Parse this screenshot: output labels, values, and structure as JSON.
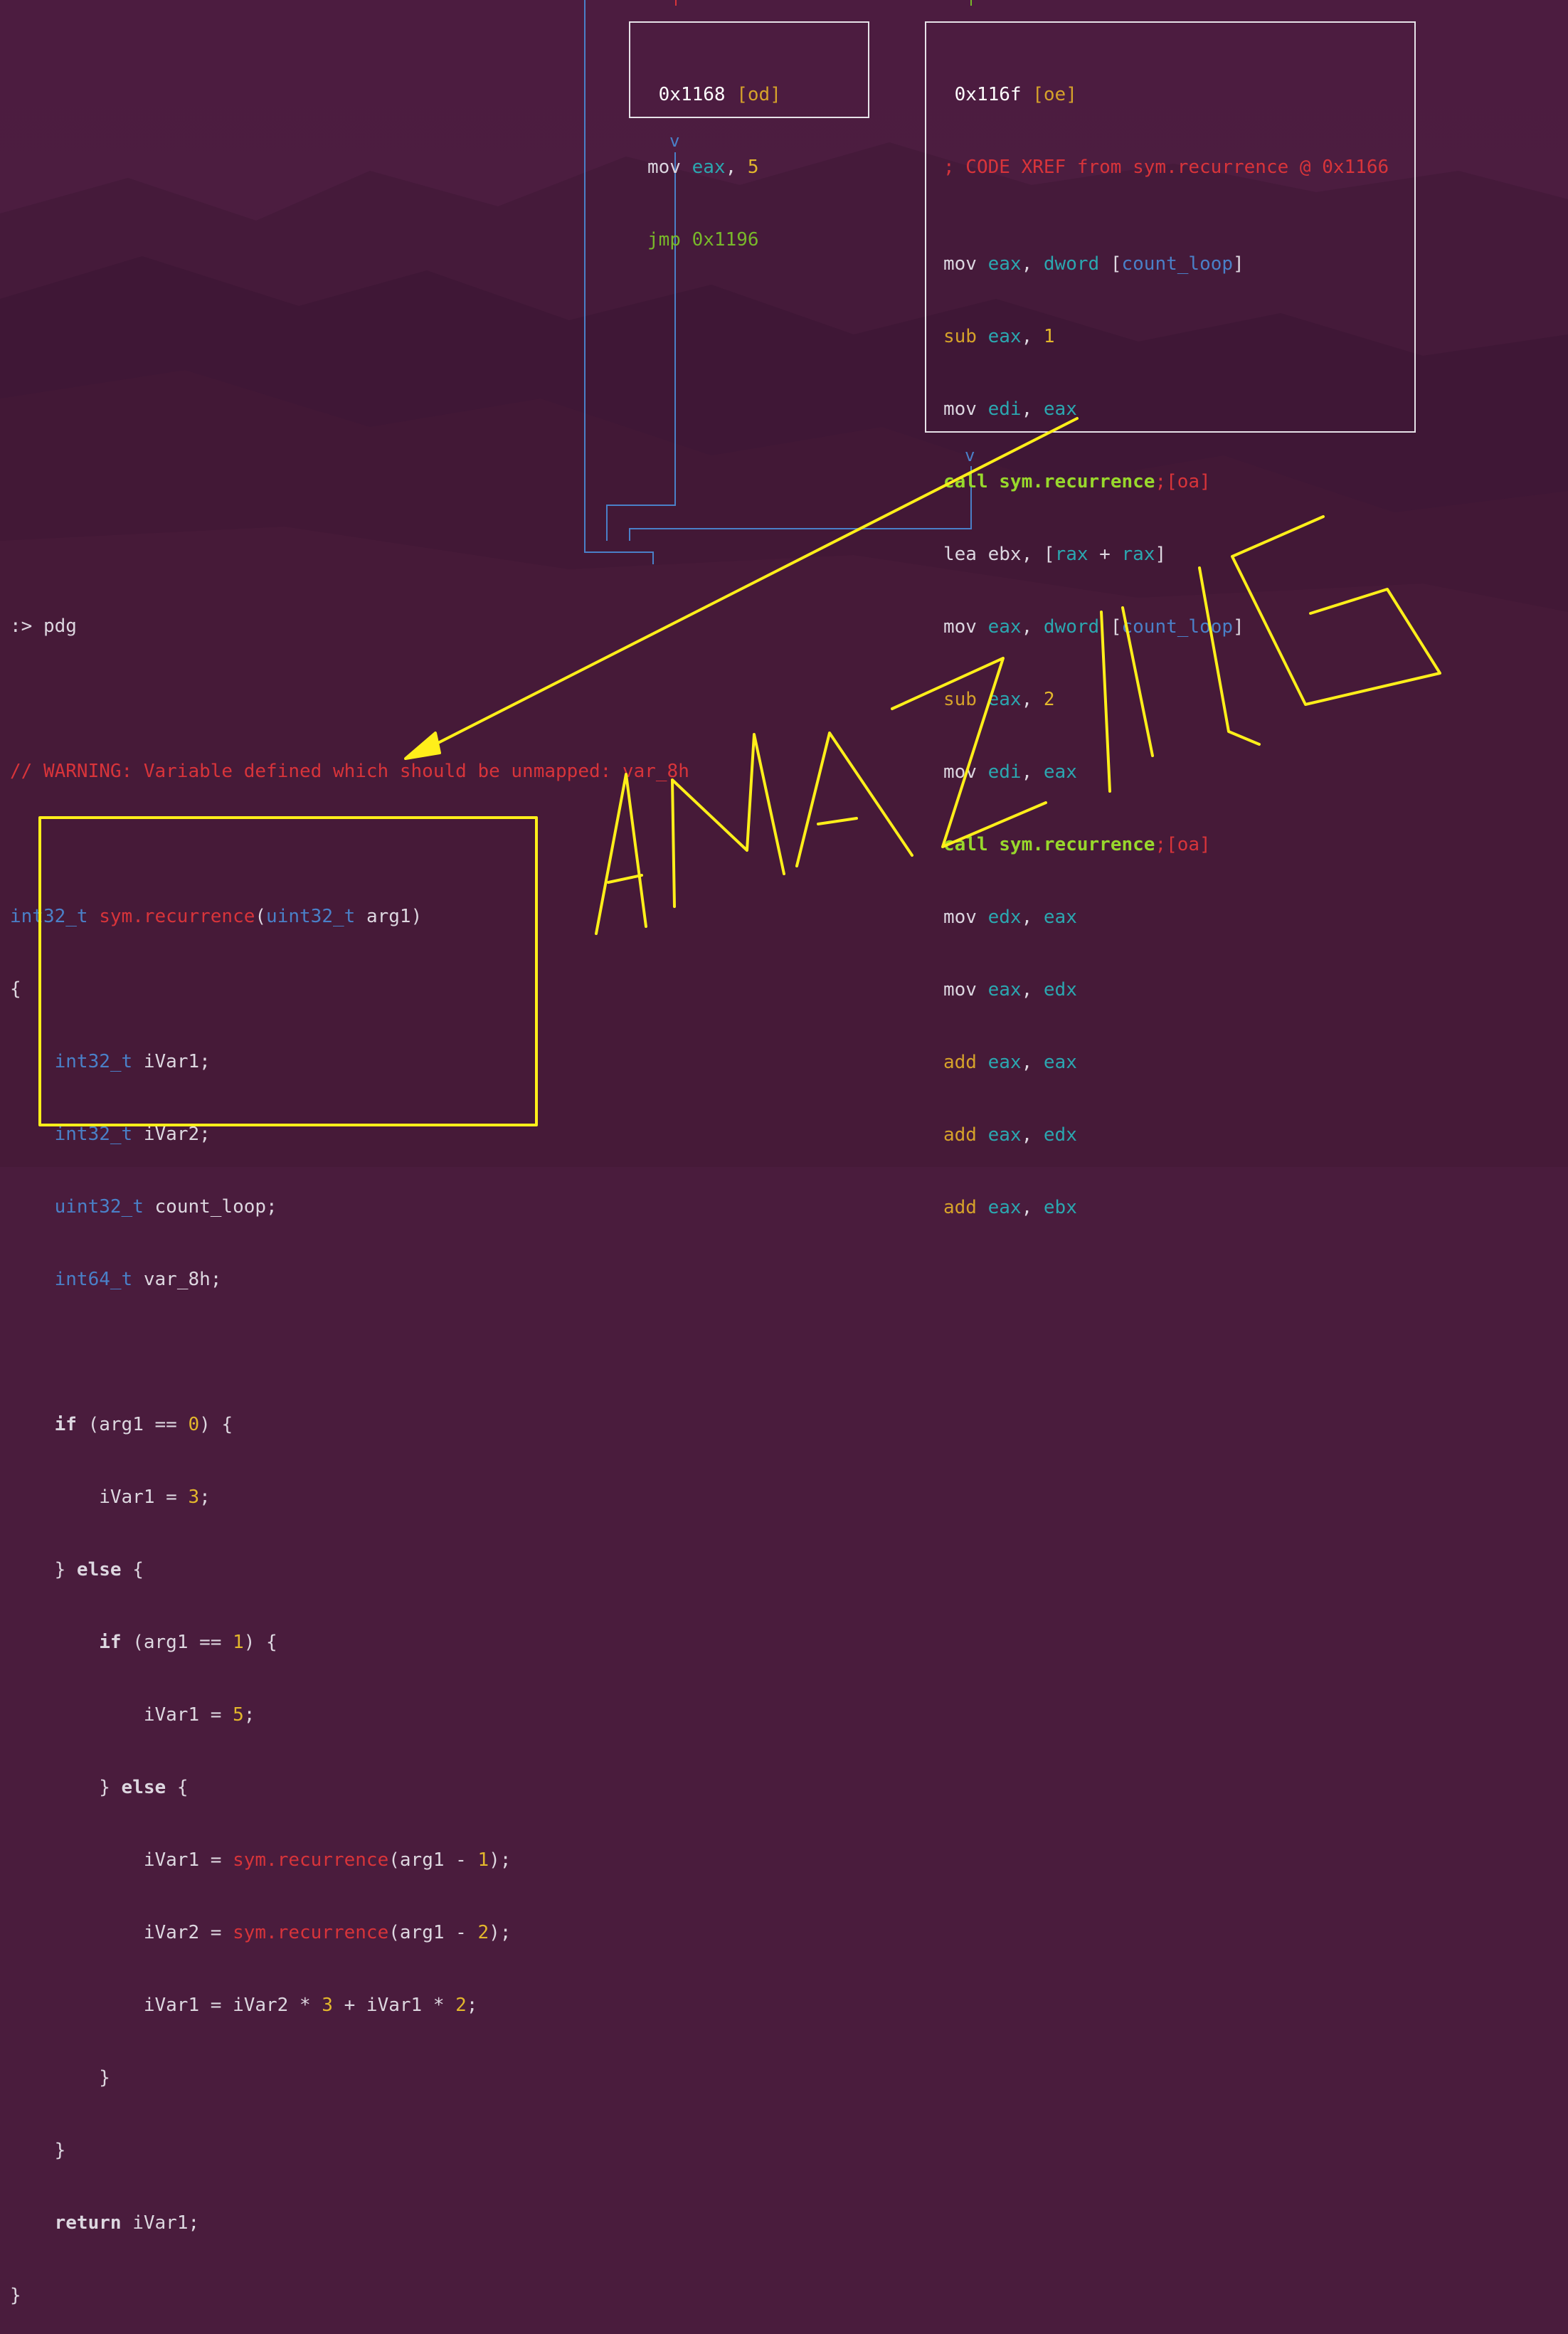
{
  "graph": {
    "block_od": {
      "header_addr": "0x1168",
      "header_tag": "[od]",
      "lines": [
        {
          "op": "mov",
          "a": "eax",
          "sep": ", ",
          "b": "5"
        },
        {
          "op": "jmp",
          "a": "0x1196"
        }
      ]
    },
    "block_oe": {
      "header_addr": "0x116f",
      "header_tag": "[oe]",
      "xref": "; CODE XREF from sym.recurrence @ 0x1166",
      "lines": [
        {
          "op": "mov",
          "a": "eax",
          "sep": ", ",
          "b": "dword",
          "mem": "count_loop"
        },
        {
          "op": "sub",
          "a": "eax",
          "sep": ", ",
          "b": "1"
        },
        {
          "op": "mov",
          "a": "edi",
          "sep": ", ",
          "b": "eax"
        },
        {
          "op": "call",
          "a": "sym.recurrence",
          "suffix": ";[oa]"
        },
        {
          "op": "lea",
          "a": "ebx",
          "sep": ", ",
          "mem_a": "rax",
          "plus": " + ",
          "mem_b": "rax"
        },
        {
          "op": "mov",
          "a": "eax",
          "sep": ", ",
          "b": "dword",
          "mem": "count_loop"
        },
        {
          "op": "sub",
          "a": "eax",
          "sep": ", ",
          "b": "2"
        },
        {
          "op": "mov",
          "a": "edi",
          "sep": ", ",
          "b": "eax"
        },
        {
          "op": "call",
          "a": "sym.recurrence",
          "suffix": ";[oa]"
        },
        {
          "op": "mov",
          "a": "edx",
          "sep": ", ",
          "b": "eax"
        },
        {
          "op": "mov",
          "a": "eax",
          "sep": ", ",
          "b": "edx"
        },
        {
          "op": "add",
          "a": "eax",
          "sep": ", ",
          "b": "eax"
        },
        {
          "op": "add",
          "a": "eax",
          "sep": ", ",
          "b": "edx"
        },
        {
          "op": "add",
          "a": "eax",
          "sep": ", ",
          "b": "ebx"
        }
      ]
    },
    "arrow_v": "v"
  },
  "console": {
    "prompt": ":> ",
    "command": "pdg",
    "warning": "// WARNING: Variable defined which should be unmapped: var_8h",
    "signature": {
      "ret_type": "int32_t",
      "name": "sym.recurrence",
      "arg_type": "uint32_t",
      "arg": "arg1"
    },
    "open_brace": "{",
    "decls": [
      {
        "type": "int32_t",
        "name": "iVar1;"
      },
      {
        "type": "int32_t",
        "name": "iVar2;"
      },
      {
        "type": "uint32_t",
        "name": "count_loop;"
      },
      {
        "type": "int64_t",
        "name": "var_8h;"
      }
    ],
    "close_brace": "}",
    "final_prompt": ":> "
  },
  "annotation": {
    "text": "AMAZING",
    "color": "#ffef1a"
  },
  "colors": {
    "accent_yellow": "#ffef1a",
    "edge_blue": "#4a80c8",
    "edge_red": "#d8343a",
    "edge_green": "#78b82a"
  }
}
